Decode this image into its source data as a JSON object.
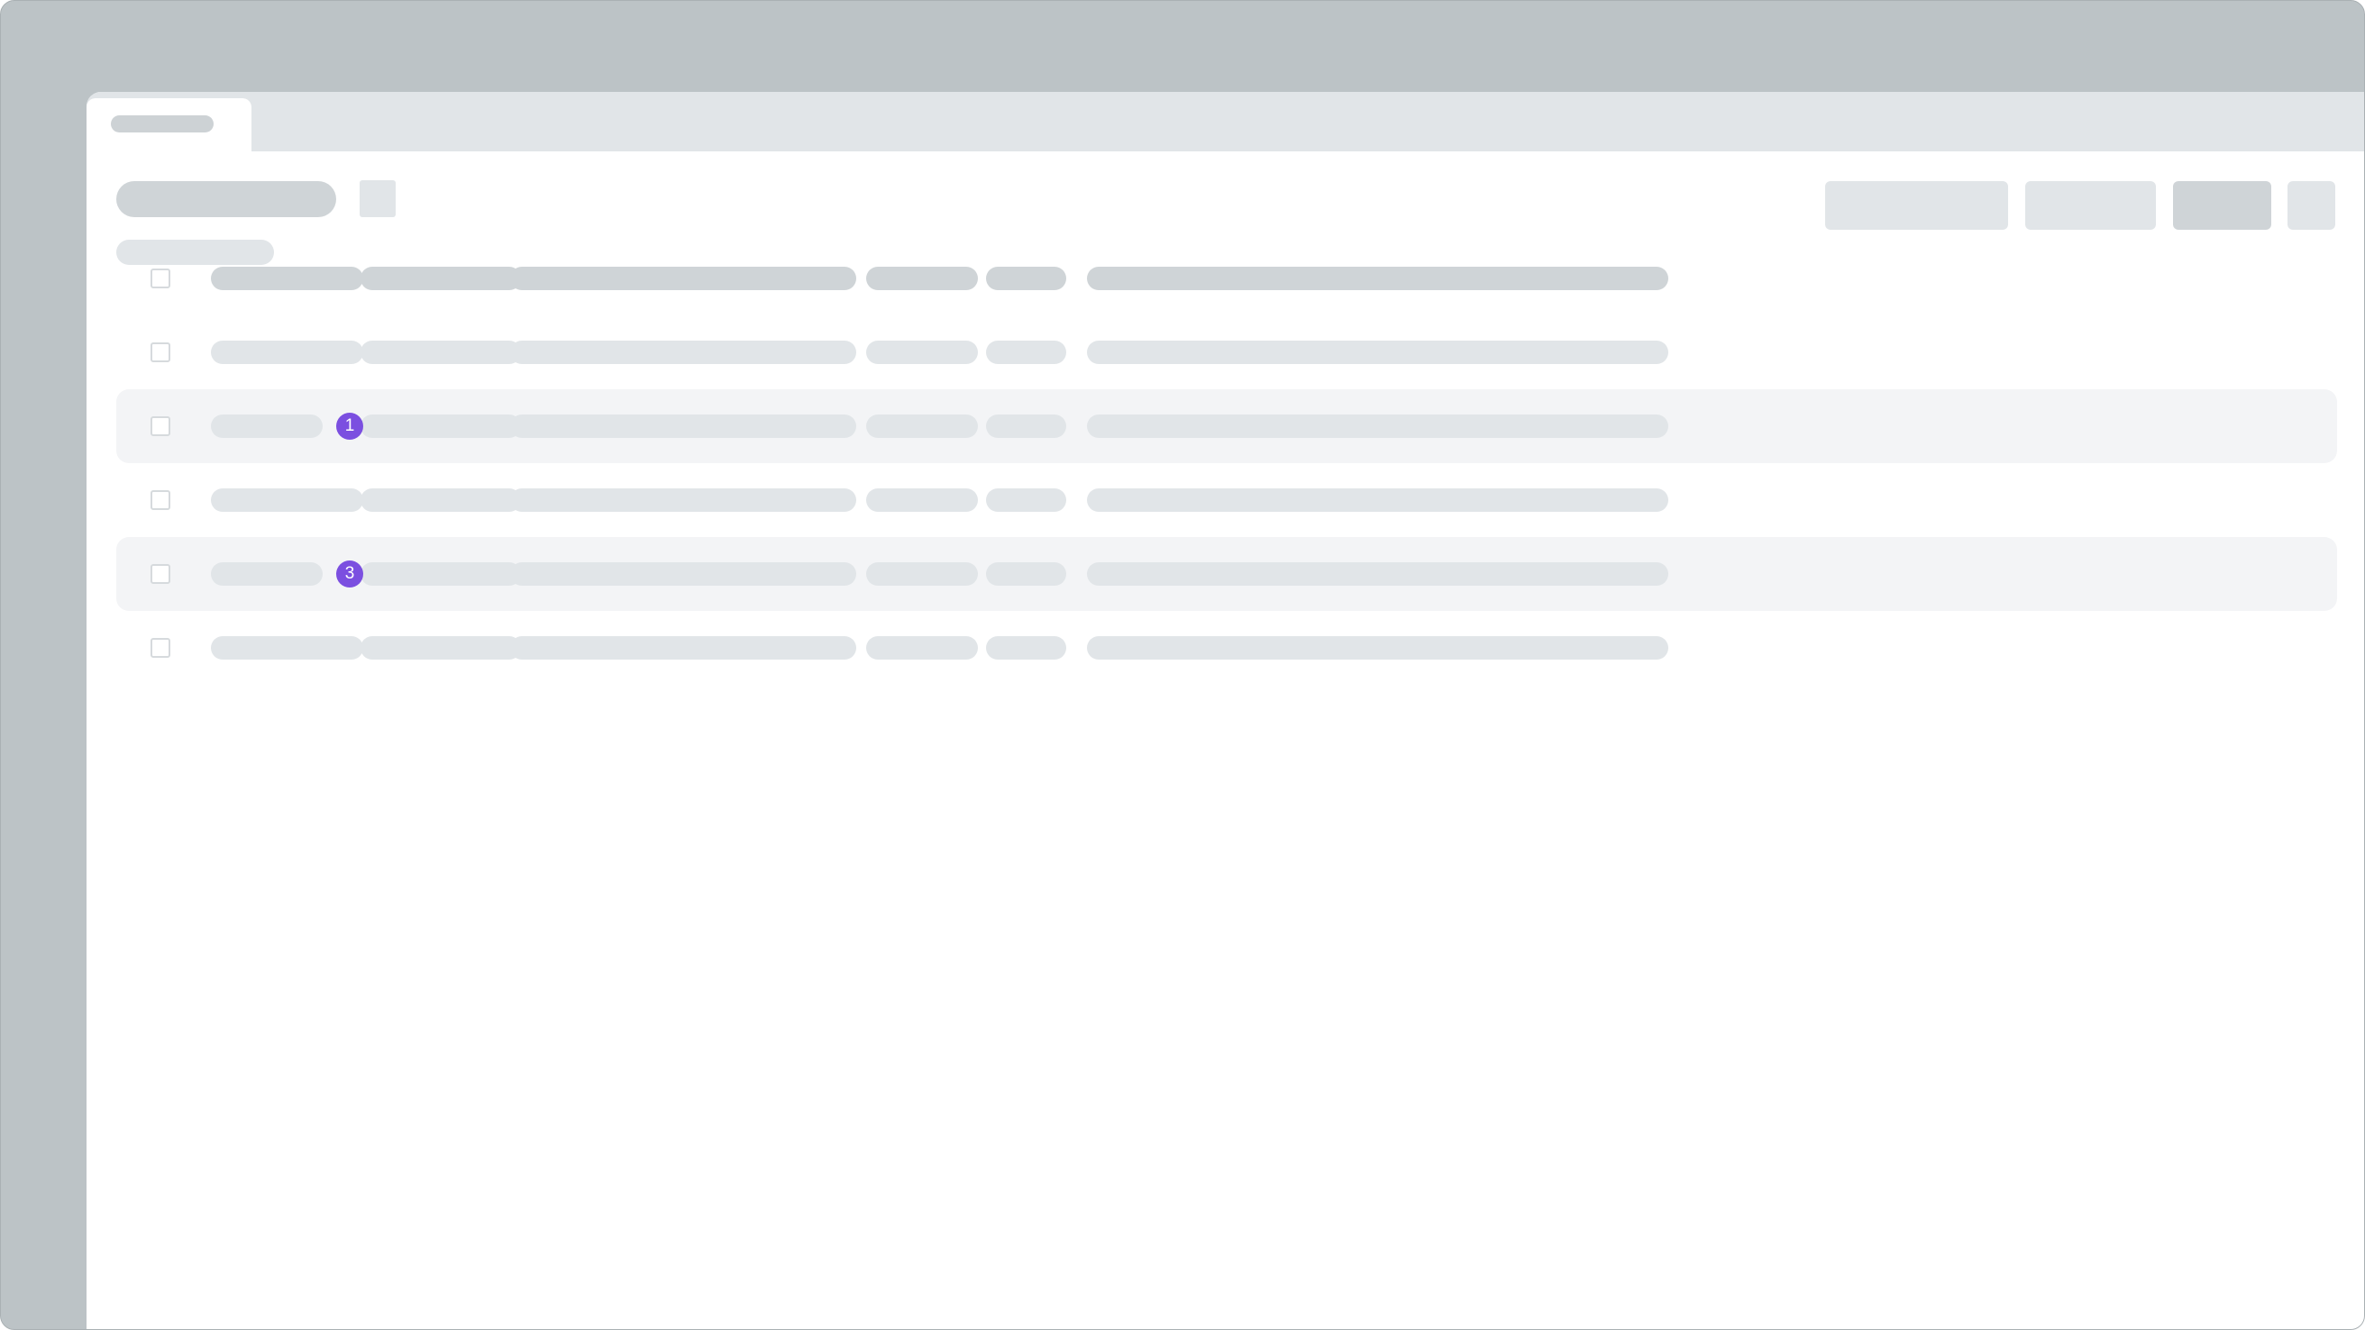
{
  "window": {
    "tab": {
      "label": ""
    }
  },
  "header": {
    "title": "",
    "subtitle": "",
    "actions": [
      "",
      "",
      "",
      ""
    ]
  },
  "table": {
    "columns": [
      "",
      "",
      "",
      "",
      "",
      "",
      ""
    ],
    "rows": [
      {
        "highlighted": false,
        "badge": ""
      },
      {
        "highlighted": true,
        "badge": "1"
      },
      {
        "highlighted": false,
        "badge": ""
      },
      {
        "highlighted": true,
        "badge": "3"
      },
      {
        "highlighted": false,
        "badge": ""
      }
    ]
  },
  "colors": {
    "frame": "#bcc3c6",
    "tabstrip": "#e1e5e8",
    "skeleton_dark": "#cfd4d7",
    "skeleton_light": "#e1e5e8",
    "row_highlight": "#f3f4f6",
    "badge": "#7b4fe0"
  }
}
